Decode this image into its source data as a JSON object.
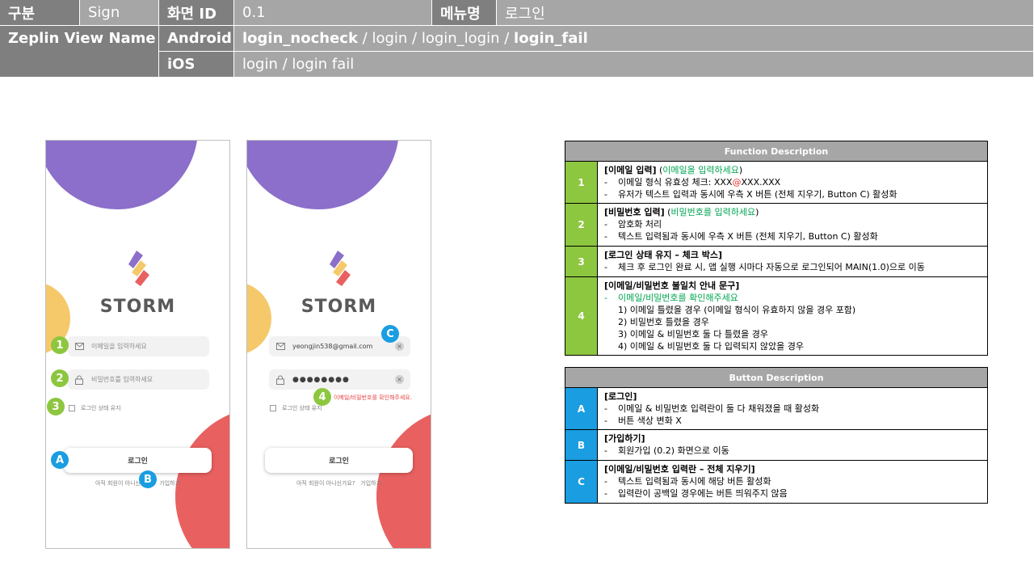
{
  "header": {
    "row1": {
      "label_gubun": "구분",
      "gubun": "Sign",
      "label_screen_id": "화면 ID",
      "screen_id": "0.1",
      "label_menu": "메뉴명",
      "menu": "로그인"
    },
    "row2": {
      "label_zeplin": "Zeplin View Name",
      "android_label": "Android",
      "android_a": "login_nocheck",
      "android_sep1": " / ",
      "android_b": "login",
      "android_sep2": " / ",
      "android_c": "login_login",
      "android_sep3": " / ",
      "android_d": "login_fail"
    },
    "row3": {
      "ios_label": "iOS",
      "ios_value": "login / login fail"
    }
  },
  "phone1": {
    "brand": "STORM",
    "email_placeholder": "이메일을 입력하세요",
    "password_placeholder": "비밀번호를 입력하세요",
    "keep_login": "로그인 상태 유지",
    "login_button": "로그인",
    "signup_question": "아직 회원이 아니신가요?",
    "signup_link": "가입하기"
  },
  "phone2": {
    "brand": "STORM",
    "email_value": "yeongjin538@gmail.com",
    "password_value": "●●●●●●●●",
    "error_message": "이메일/비밀번호를 확인해주세요.",
    "keep_login": "로그인 상태 유지",
    "login_button": "로그인",
    "signup_question": "아직 회원이 아니신가요?",
    "signup_link": "가입하기"
  },
  "badges": {
    "one": "1",
    "two": "2",
    "three": "3",
    "four": "4",
    "a": "A",
    "b": "B",
    "c": "C"
  },
  "function_table": {
    "title": "Function Description",
    "rows": [
      {
        "num": "1",
        "title": "[이메일 입력]",
        "hint_open": " (",
        "hint": "이메일을 입력하세요",
        "hint_close": ")",
        "items": [
          {
            "dash": "-",
            "pre": "이메일 형식 유효성 체크: XXX",
            "at": "@",
            "post": "XXX.XXX"
          },
          {
            "dash": "-",
            "text": "유저가 텍스트 입력과 동시에 우측 X 버튼 (전체 지우기, Button C) 활성화"
          }
        ]
      },
      {
        "num": "2",
        "title": "[비밀번호 입력]",
        "hint_open": " (",
        "hint": "비밀번호를 입력하세요",
        "hint_close": ")",
        "items": [
          {
            "dash": "-",
            "text": "암호화 처리"
          },
          {
            "dash": "-",
            "text": "텍스트 입력됨과 동시에 우측 X 버튼 (전체 지우기, Button C) 활성화"
          }
        ]
      },
      {
        "num": "3",
        "title": "[로그인 상태 유지 – 체크 박스]",
        "items": [
          {
            "dash": "-",
            "text": "체크 후 로그인 완료 시, 앱 실행 시마다 자동으로 로그인되어 MAIN(1.0)으로 이동"
          }
        ]
      },
      {
        "num": "4",
        "title": "[이메일/비밀번호 불일치 안내 문구]",
        "items": [
          {
            "dash": "-",
            "text": "이메일/비밀번호를 확인해주세요"
          }
        ],
        "subs": [
          "1) 이메일 틀렸을 경우 (이메일 형식이 유효하지 않을 경우 포함)",
          "2) 비밀번호 틀렸을 경우",
          "3) 이메일 & 비밀번호 둘 다 틀렸을 경우",
          "4) 이메일 & 비밀번호 둘 다 입력되지 않았을 경우"
        ]
      }
    ]
  },
  "button_table": {
    "title": "Button Description",
    "rows": [
      {
        "num": "A",
        "title": "[로그인]",
        "items": [
          {
            "dash": "-",
            "text": "이메일 & 비밀번호 입력란이 둘 다 채워졌을 때 활성화"
          },
          {
            "dash": "-",
            "text": "버튼 색상 변화 X"
          }
        ]
      },
      {
        "num": "B",
        "title": "[가입하기]",
        "items": [
          {
            "dash": "-",
            "text": "회원가입 (0.2) 화면으로 이동"
          }
        ]
      },
      {
        "num": "C",
        "title": "[이메일/비밀번호 입력란 – 전체 지우기]",
        "items": [
          {
            "dash": "-",
            "text": "텍스트 입력됨과 동시에 해당 버튼 활성화"
          },
          {
            "dash": "-",
            "text": "입력란이 공백일 경우에는 버튼 띄워주지 않음"
          }
        ]
      }
    ]
  },
  "colors": {
    "header_dark": "#7f7f7f",
    "header_light": "#a6a6a6",
    "badge_green": "#8dc63f",
    "badge_blue": "#1a9de1",
    "hint_green": "#00a651",
    "error_red": "#e84545",
    "circle_purple": "#8b6fca",
    "circle_yellow": "#f5c96a",
    "circle_red": "#e96060"
  }
}
